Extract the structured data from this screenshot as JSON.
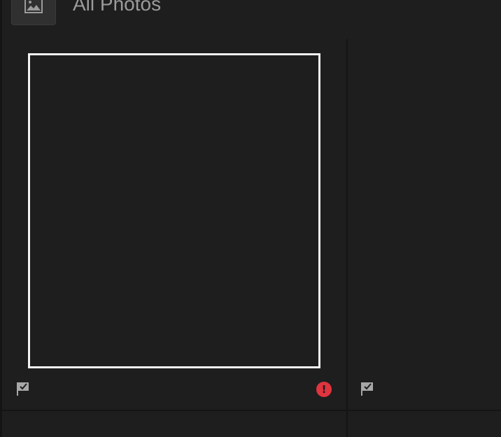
{
  "header": {
    "title": "All Photos",
    "icon": "photo-icon"
  },
  "grid": {
    "cells": [
      {
        "flag_icon": "flag-check-icon",
        "status_icon": "error-icon",
        "status_glyph": "!",
        "selected": true
      },
      {
        "flag_icon": "flag-check-icon",
        "selected": false
      }
    ]
  },
  "colors": {
    "background": "#1e1e1e",
    "divider": "#141414",
    "selection_border": "#f2f2f2",
    "error": "#e0343f",
    "header_button": "#303030",
    "title_text": "#9b9b9b"
  }
}
